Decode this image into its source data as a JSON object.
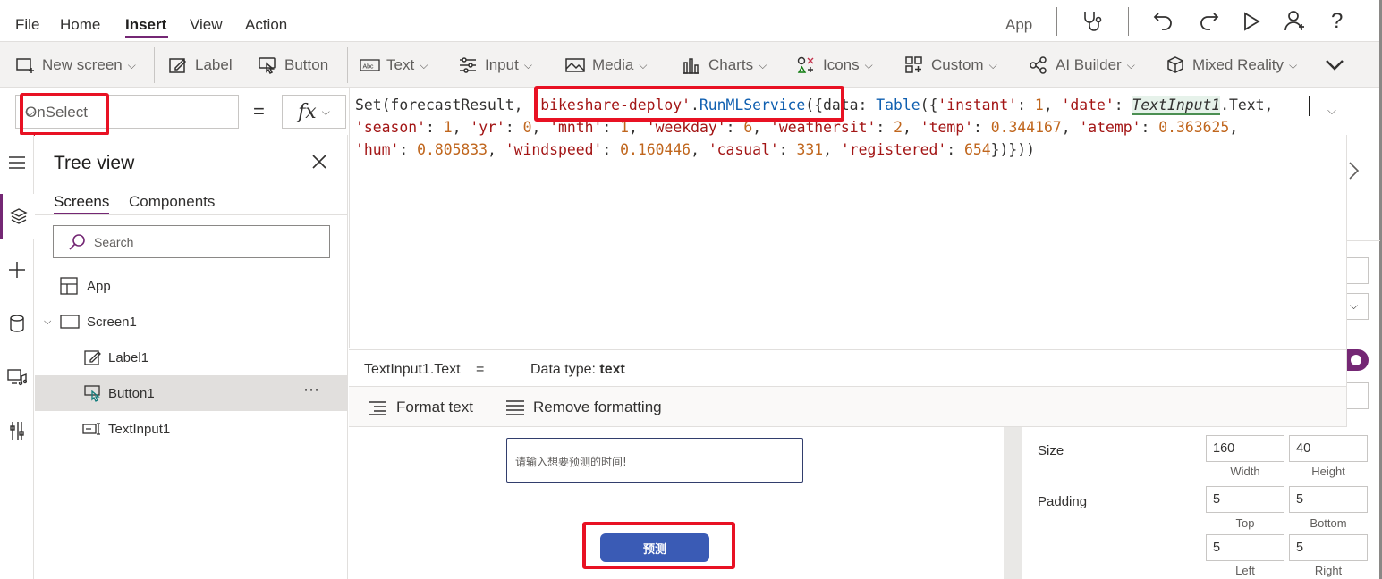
{
  "menubar": {
    "items": [
      {
        "label": "File"
      },
      {
        "label": "Home"
      },
      {
        "label": "Insert"
      },
      {
        "label": "View"
      },
      {
        "label": "Action"
      }
    ],
    "active": "Insert",
    "app_label": "App"
  },
  "ribbon": {
    "items": [
      {
        "label": "New screen",
        "icon": "new-screen-icon",
        "dropdown": true
      },
      {
        "label": "Label",
        "icon": "label-edit-icon",
        "dropdown": false
      },
      {
        "label": "Button",
        "icon": "button-click-icon",
        "dropdown": false
      },
      {
        "label": "Text",
        "icon": "text-abc-icon",
        "dropdown": true
      },
      {
        "label": "Input",
        "icon": "input-sliders-icon",
        "dropdown": true
      },
      {
        "label": "Media",
        "icon": "media-image-icon",
        "dropdown": true
      },
      {
        "label": "Charts",
        "icon": "charts-bar-icon",
        "dropdown": true
      },
      {
        "label": "Icons",
        "icon": "icons-shapes-icon",
        "dropdown": true
      },
      {
        "label": "Custom",
        "icon": "custom-component-icon",
        "dropdown": true
      },
      {
        "label": "AI Builder",
        "icon": "ai-builder-icon",
        "dropdown": true
      },
      {
        "label": "Mixed Reality",
        "icon": "mixed-reality-cube-icon",
        "dropdown": true
      }
    ]
  },
  "formula_bar": {
    "property": "OnSelect",
    "equals": "=",
    "fx": "fx",
    "formula_lines": [
      [
        [
          "i",
          "Set(forecastResult, "
        ],
        [
          "s",
          "'bikeshare-deploy'"
        ],
        [
          "i",
          "."
        ],
        [
          "f",
          "RunMLService"
        ],
        [
          "i",
          "({data: "
        ],
        [
          "f",
          "Table"
        ],
        [
          "i",
          "({"
        ],
        [
          "s",
          "'instant'"
        ],
        [
          "i",
          ": "
        ],
        [
          "n",
          "1"
        ],
        [
          "i",
          ", "
        ],
        [
          "s",
          "'date'"
        ],
        [
          "i",
          ": "
        ],
        [
          "c",
          "TextInput1"
        ],
        [
          "i",
          ".Text"
        ],
        [
          "i",
          ","
        ]
      ],
      [
        [
          "s",
          "'season'"
        ],
        [
          "i",
          ": "
        ],
        [
          "n",
          "1"
        ],
        [
          "i",
          ", "
        ],
        [
          "s",
          "'yr'"
        ],
        [
          "i",
          ": "
        ],
        [
          "n",
          "0"
        ],
        [
          "i",
          ", "
        ],
        [
          "s",
          "'mnth'"
        ],
        [
          "i",
          ": "
        ],
        [
          "n",
          "1"
        ],
        [
          "i",
          ", "
        ],
        [
          "s",
          "'weekday'"
        ],
        [
          "i",
          ": "
        ],
        [
          "n",
          "6"
        ],
        [
          "i",
          ", "
        ],
        [
          "s",
          "'weathersit'"
        ],
        [
          "i",
          ": "
        ],
        [
          "n",
          "2"
        ],
        [
          "i",
          ", "
        ],
        [
          "s",
          "'temp'"
        ],
        [
          "i",
          ": "
        ],
        [
          "n",
          "0.344167"
        ],
        [
          "i",
          ", "
        ],
        [
          "s",
          "'atemp'"
        ],
        [
          "i",
          ": "
        ],
        [
          "n",
          "0.363625"
        ],
        [
          "i",
          ","
        ]
      ],
      [
        [
          "s",
          "'hum'"
        ],
        [
          "i",
          ": "
        ],
        [
          "n",
          "0.805833"
        ],
        [
          "i",
          ", "
        ],
        [
          "s",
          "'windspeed'"
        ],
        [
          "i",
          ": "
        ],
        [
          "n",
          "0.160446"
        ],
        [
          "i",
          ", "
        ],
        [
          "s",
          "'casual'"
        ],
        [
          "i",
          ": "
        ],
        [
          "n",
          "331"
        ],
        [
          "i",
          ", "
        ],
        [
          "s",
          "'registered'"
        ],
        [
          "i",
          ": "
        ],
        [
          "n",
          "654"
        ],
        [
          "i",
          "})}))"
        ]
      ]
    ],
    "hint_expression": "TextInput1.Text",
    "hint_equals": "=",
    "data_type_label": "Data type: ",
    "data_type_value": "text",
    "format_text_label": "Format text",
    "remove_formatting_label": "Remove formatting"
  },
  "tree_view": {
    "title": "Tree view",
    "tabs": [
      {
        "label": "Screens",
        "active": true
      },
      {
        "label": "Components",
        "active": false
      }
    ],
    "search_placeholder": "Search",
    "items": [
      {
        "label": "App",
        "icon": "app-icon",
        "level": 0,
        "selected": false
      },
      {
        "label": "Screen1",
        "icon": "screen-icon",
        "level": 0,
        "selected": false,
        "expanded": true
      },
      {
        "label": "Label1",
        "icon": "label-edit-icon",
        "level": 1,
        "selected": false
      },
      {
        "label": "Button1",
        "icon": "button-click-icon",
        "level": 1,
        "selected": true
      },
      {
        "label": "TextInput1",
        "icon": "text-input-icon",
        "level": 1,
        "selected": false
      }
    ],
    "more_label": "⋯"
  },
  "canvas": {
    "text_input_placeholder": "请输入想要预测的时间!",
    "button_label": "预测",
    "button_color": "#3a5bb5"
  },
  "properties": {
    "size_label": "Size",
    "width_value": "160",
    "width_caption": "Width",
    "height_value": "40",
    "height_caption": "Height",
    "padding_label": "Padding",
    "padding_top": "5",
    "padding_top_caption": "Top",
    "padding_bottom": "5",
    "padding_bottom_caption": "Bottom",
    "padding_left": "5",
    "padding_left_caption": "Left",
    "padding_right": "5",
    "padding_right_caption": "Right"
  },
  "colors": {
    "accent": "#742774",
    "highlight_red": "#e81123",
    "string": "#a31515",
    "function": "#0f5fb0",
    "number": "#c0661d"
  }
}
